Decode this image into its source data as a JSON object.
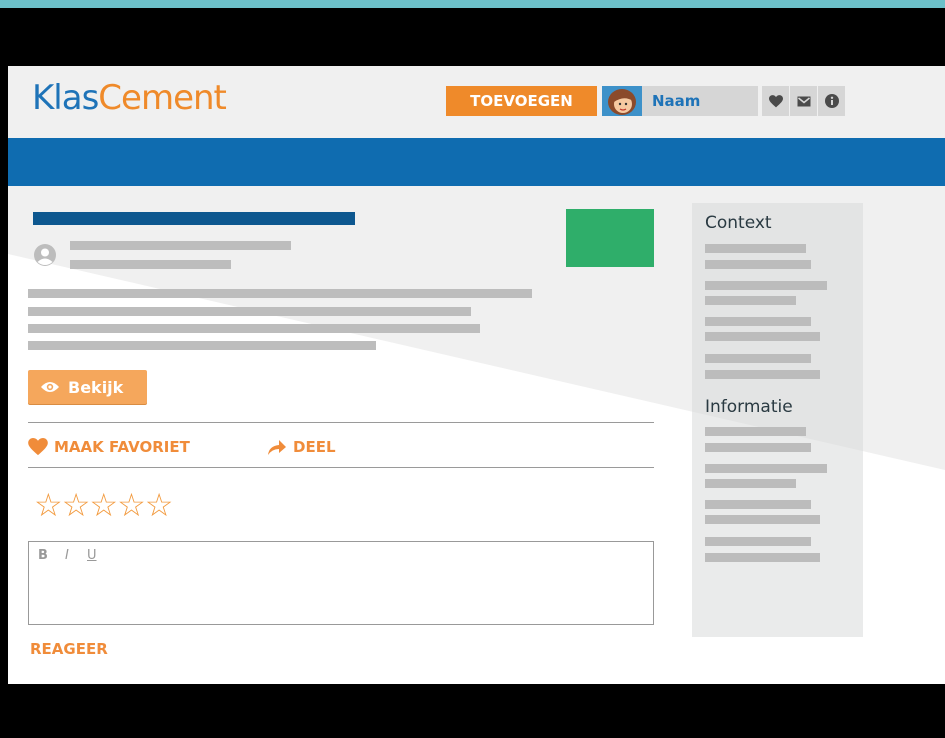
{
  "brand": {
    "logo_part1": "Klas",
    "logo_part2": "Cement"
  },
  "header": {
    "add_label": "TOEVOEGEN",
    "user_name": "Naam",
    "icons": [
      "heart-icon",
      "mail-icon",
      "info-icon"
    ]
  },
  "content": {
    "view_button": "Bekijk",
    "favorite_label": "MAAK FAVORIET",
    "share_label": "DEEL",
    "rating_stars": "☆☆☆☆☆",
    "rating_value": 0,
    "rating_max": 5,
    "editor_bold": "B",
    "editor_italic": "I",
    "editor_underline": "U",
    "reply_label": "REAGEER"
  },
  "sidebar": {
    "context_title": "Context",
    "info_title": "Informatie"
  },
  "colors": {
    "brand_blue": "#1e73b8",
    "brand_orange": "#ef8a2a",
    "nav_blue": "#0f6cb0",
    "thumb_green": "#2fae6a"
  }
}
